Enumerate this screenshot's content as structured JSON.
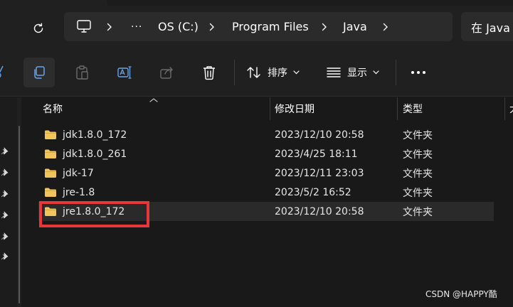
{
  "address": {
    "path": [
      "OS (C:)",
      "Program Files",
      "Java"
    ],
    "overflow_label": "···",
    "search_placeholder": "在 Java"
  },
  "toolbar": {
    "sort_label": "排序",
    "view_label": "显示",
    "more_label": "···"
  },
  "columns": {
    "name": "名称",
    "date": "修改日期",
    "type": "类型",
    "size": "大"
  },
  "rows": [
    {
      "name": "jdk1.8.0_172",
      "date": "2023/12/10 20:58",
      "type": "文件夹"
    },
    {
      "name": "jdk1.8.0_261",
      "date": "2023/4/25 18:11",
      "type": "文件夹"
    },
    {
      "name": "jdk-17",
      "date": "2023/12/11 23:03",
      "type": "文件夹"
    },
    {
      "name": "jre-1.8",
      "date": "2023/5/2 16:52",
      "type": "文件夹"
    },
    {
      "name": "jre1.8.0_172",
      "date": "2023/12/10 20:58",
      "type": "文件夹"
    }
  ],
  "watermark": "CSDN @HAPPY酷",
  "colors": {
    "background": "#191919",
    "chrome": "#202020",
    "selected_row": "#2a2a2a",
    "folder": "#f2c55c",
    "highlight": "#e8373b"
  }
}
